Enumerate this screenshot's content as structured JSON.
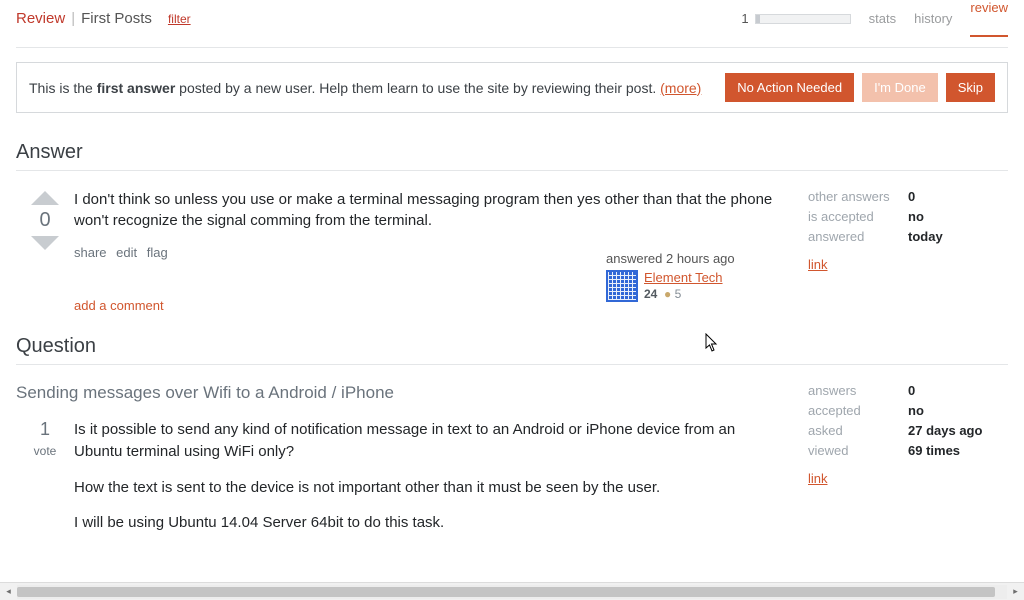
{
  "topbar": {
    "review_label": "Review",
    "separator": "|",
    "page_label": "First Posts",
    "filter_label": "filter",
    "progress_count": "1",
    "tabs": {
      "stats": "stats",
      "history": "history",
      "review": "review"
    }
  },
  "notice": {
    "pre": "This is the ",
    "bold": "first answer",
    "post": " posted by a new user. Help them learn to use the site by reviewing their post. ",
    "more": "(more)",
    "buttons": {
      "no_action": "No Action Needed",
      "im_done": "I'm Done",
      "skip": "Skip"
    }
  },
  "answer": {
    "section_title": "Answer",
    "score": "0",
    "body": "I don't think so unless you use or make a terminal messaging program then yes other than that the phone won't recognize the signal comming from the terminal.",
    "actions": {
      "share": "share",
      "edit": "edit",
      "flag": "flag"
    },
    "user_card": {
      "answered": "answered 2 hours ago",
      "name": "Element Tech",
      "rep": "24",
      "bronze_dot": "●",
      "bronze_count": "5"
    },
    "add_comment": "add a comment",
    "side": {
      "other_answers": {
        "k": "other answers",
        "v": "0"
      },
      "is_accepted": {
        "k": "is accepted",
        "v": "no"
      },
      "answered": {
        "k": "answered",
        "v": "today"
      },
      "link": "link"
    }
  },
  "question": {
    "section_title": "Question",
    "title": "Sending messages over Wifi to a Android / iPhone",
    "votes": "1",
    "vote_label": "vote",
    "para1": "Is it possible to send any kind of notification message in text to an Android or iPhone device from an Ubuntu terminal using WiFi only?",
    "para2": "How the text is sent to the device is not important other than it must be seen by the user.",
    "para3": "I will be using Ubuntu 14.04 Server 64bit to do this task.",
    "side": {
      "answers": {
        "k": "answers",
        "v": "0"
      },
      "accepted": {
        "k": "accepted",
        "v": "no"
      },
      "asked": {
        "k": "asked",
        "v": "27 days ago"
      },
      "viewed": {
        "k": "viewed",
        "v": "69 times"
      },
      "link": "link"
    }
  }
}
